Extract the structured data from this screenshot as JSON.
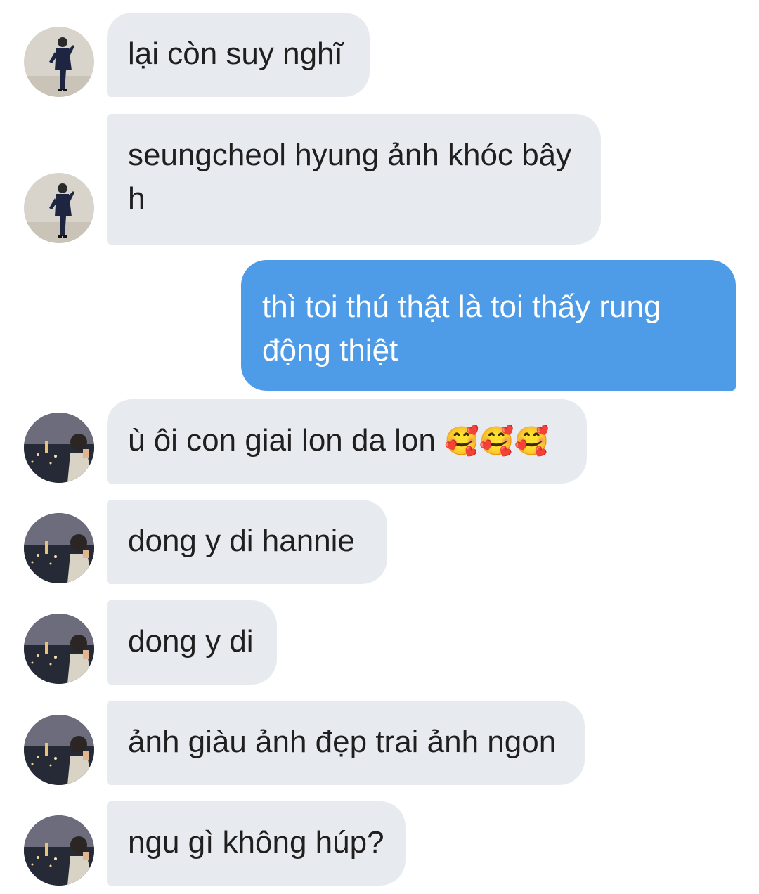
{
  "messages": [
    {
      "from": "contact_a",
      "text": "lại còn suy nghĩ"
    },
    {
      "from": "contact_a",
      "text": "seungcheol hyung ảnh khóc bây h"
    },
    {
      "from": "me",
      "text": "thì toi thú thật là toi thấy rung động thiệt"
    },
    {
      "from": "contact_b",
      "text": "ù ôi con giai lon da lon",
      "emoji": "🥰🥰🥰"
    },
    {
      "from": "contact_b",
      "text": "dong y di hannie"
    },
    {
      "from": "contact_b",
      "text": "dong y di"
    },
    {
      "from": "contact_b",
      "text": "ảnh giàu ảnh đẹp trai ảnh ngon"
    },
    {
      "from": "contact_b",
      "text": "ngu gì không húp?"
    }
  ],
  "colors": {
    "incoming_bubble": "#e7ebf0",
    "outgoing_bubble": "#4e9ce8",
    "incoming_text": "#1f1f1f",
    "outgoing_text": "#ffffff"
  }
}
